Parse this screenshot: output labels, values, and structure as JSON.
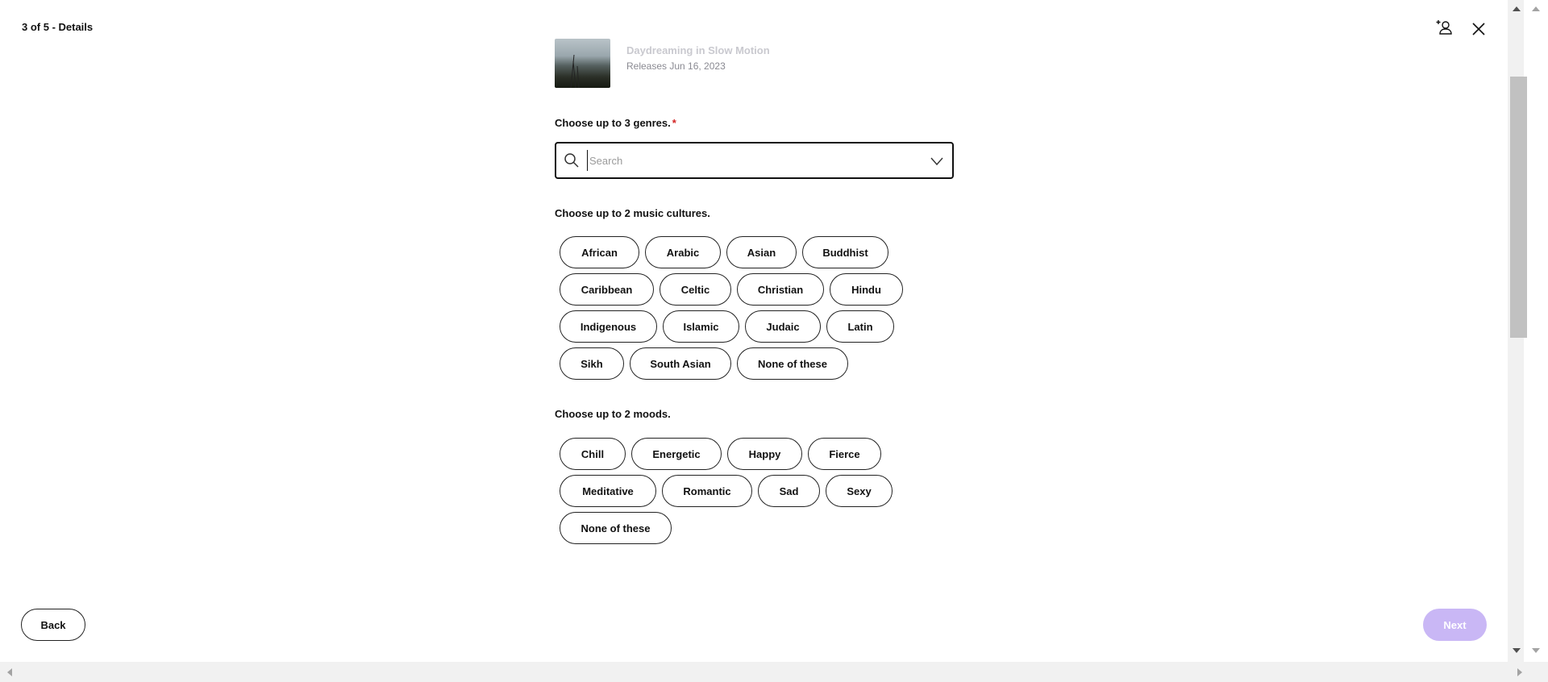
{
  "header": {
    "title": "3 of 5 - Details",
    "add_collaborator_icon": "add-person-icon",
    "close_icon": "close-icon"
  },
  "release": {
    "title": "Daydreaming in Slow Motion",
    "date": "Releases Jun 16, 2023"
  },
  "genres": {
    "label": "Choose up to 3 genres.",
    "required_marker": "*",
    "search_placeholder": "Search",
    "search_value": ""
  },
  "cultures": {
    "label": "Choose up to 2 music cultures.",
    "rows": [
      [
        "African",
        "Arabic",
        "Asian",
        "Buddhist"
      ],
      [
        "Caribbean",
        "Celtic",
        "Christian",
        "Hindu"
      ],
      [
        "Indigenous",
        "Islamic",
        "Judaic",
        "Latin"
      ],
      [
        "Sikh",
        "South Asian",
        "None of these"
      ]
    ]
  },
  "moods": {
    "label": "Choose up to 2 moods.",
    "rows": [
      [
        "Chill",
        "Energetic",
        "Happy",
        "Fierce"
      ],
      [
        "Meditative",
        "Romantic",
        "Sad",
        "Sexy"
      ],
      [
        "None of these"
      ]
    ]
  },
  "footer": {
    "back_label": "Back",
    "next_label": "Next"
  },
  "colors": {
    "next_disabled": "#c9b7f5",
    "required": "#d32222"
  }
}
